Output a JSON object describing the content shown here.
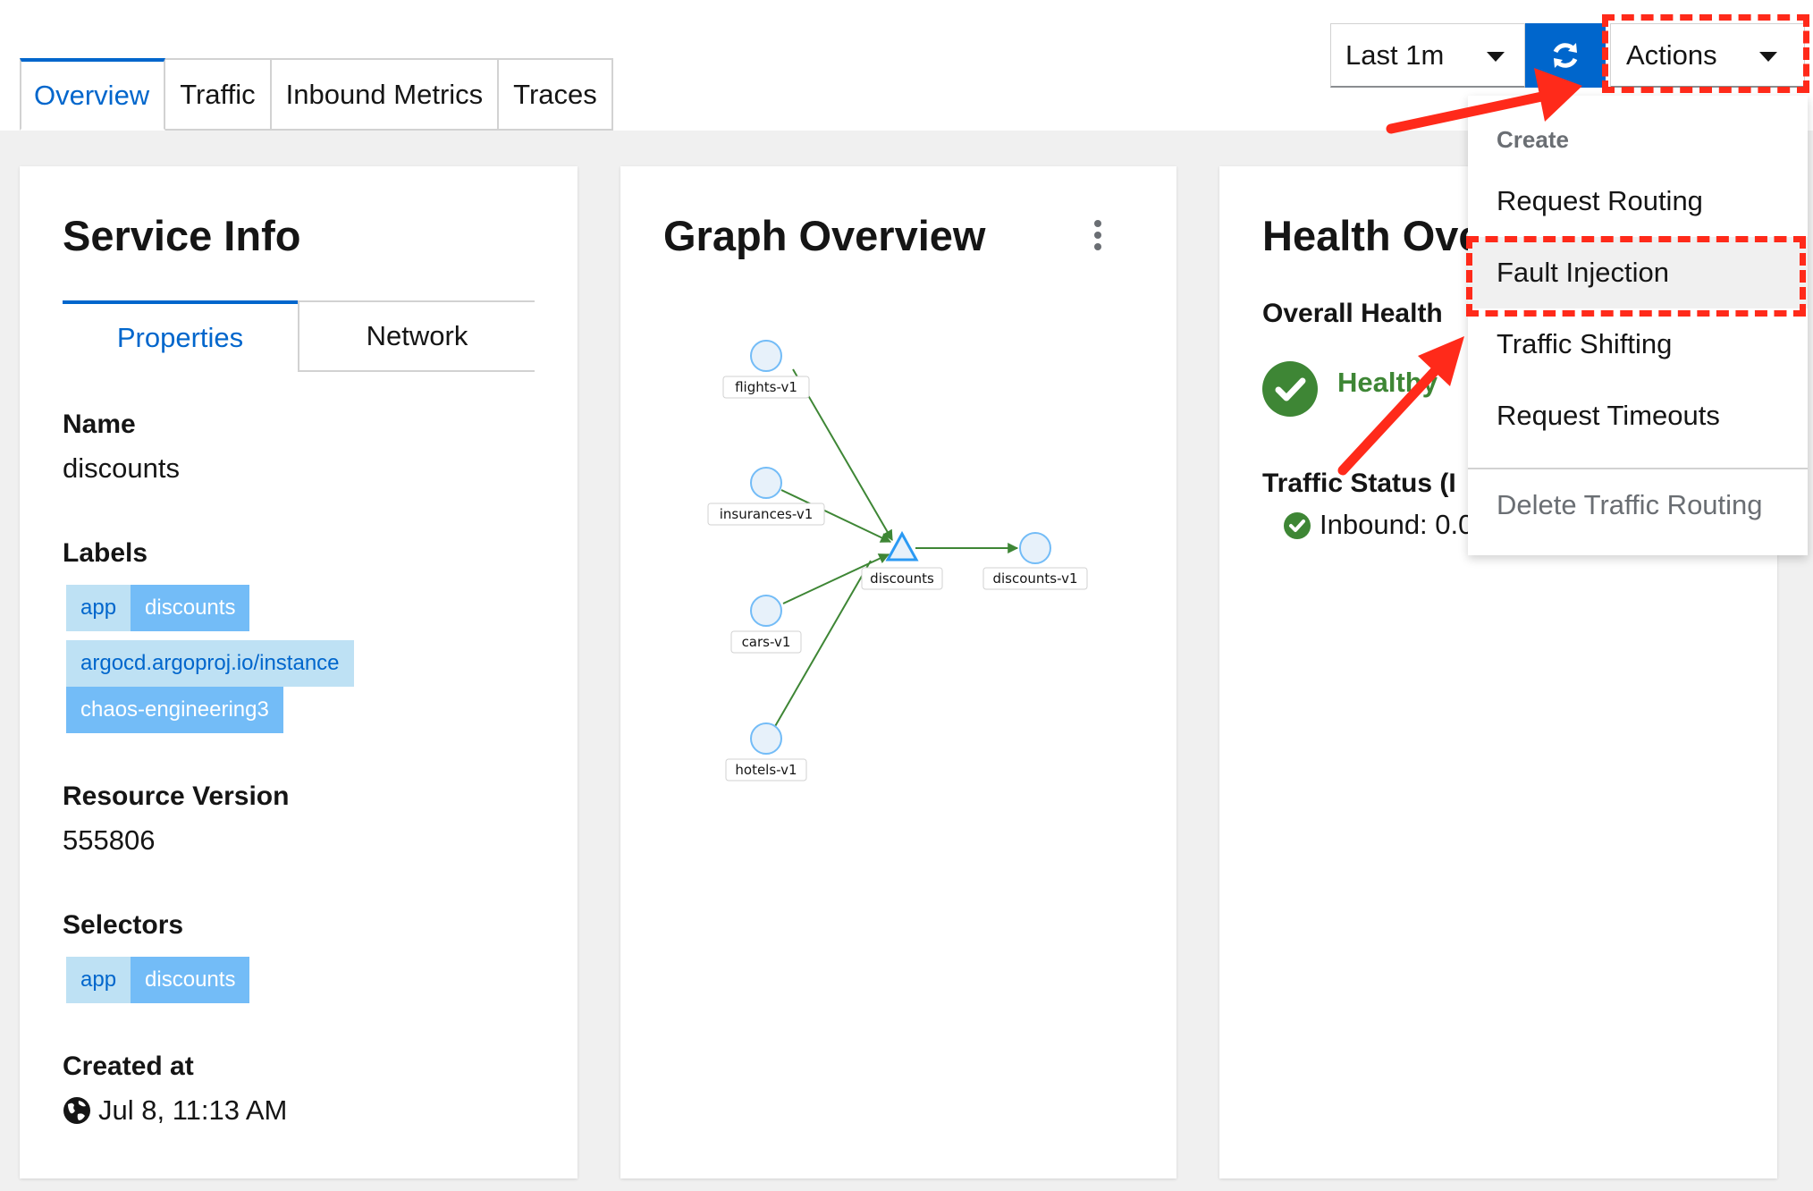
{
  "tabs": [
    {
      "label": "Overview",
      "active": true
    },
    {
      "label": "Traffic"
    },
    {
      "label": "Inbound Metrics"
    },
    {
      "label": "Traces"
    }
  ],
  "toolbar": {
    "time_range": "Last 1m",
    "refresh_icon": "refresh-icon",
    "actions_label": "Actions"
  },
  "service_info": {
    "title": "Service Info",
    "subtabs": [
      "Properties",
      "Network"
    ],
    "name_label": "Name",
    "name_value": "discounts",
    "labels_label": "Labels",
    "labels": [
      {
        "key": "app",
        "value": "discounts"
      },
      {
        "key": "argocd.argoproj.io/instance"
      },
      {
        "value": "chaos-engineering3"
      }
    ],
    "resource_version_label": "Resource Version",
    "resource_version_value": "555806",
    "selectors_label": "Selectors",
    "selectors": [
      {
        "key": "app",
        "value": "discounts"
      }
    ],
    "created_label": "Created at",
    "created_value": "Jul 8, 11:13 AM"
  },
  "graph_overview": {
    "title": "Graph Overview",
    "nodes": [
      "flights-v1",
      "insurances-v1",
      "cars-v1",
      "hotels-v1",
      "discounts",
      "discounts-v1"
    ]
  },
  "health": {
    "title": "Health Ove",
    "overall_label": "Overall Health",
    "overall_status": "Healthy",
    "traffic_status_label": "Traffic Status (I",
    "inbound_text": "Inbound: 0.0"
  },
  "actions_menu": {
    "group_label": "Create",
    "items": [
      "Request Routing",
      "Fault Injection",
      "Traffic Shifting",
      "Request Timeouts"
    ],
    "hovered": "Fault Injection",
    "delete_label": "Delete Traffic Routing"
  },
  "colors": {
    "accent": "#0066cc",
    "healthy": "#3e8635",
    "annotation": "#ff2a1a",
    "edge": "#3e8635",
    "node": "#8bc1f7"
  }
}
